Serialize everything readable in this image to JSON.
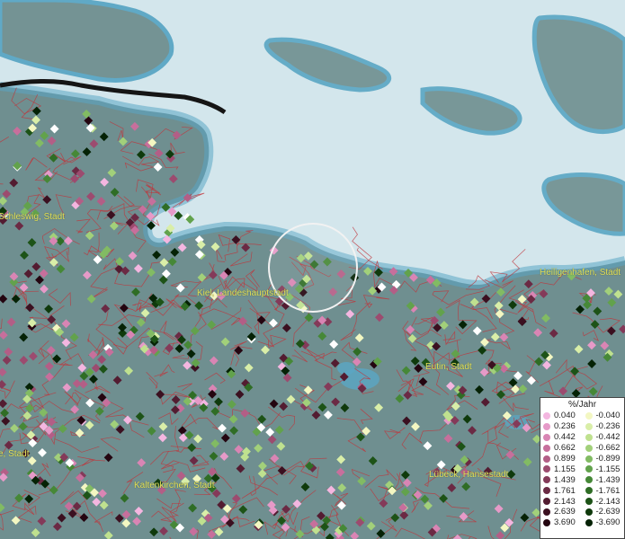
{
  "map": {
    "cities": [
      {
        "id": "schleswig",
        "label": "Schleswig, Stadt"
      },
      {
        "id": "kiel",
        "label": "Kiel, Landeshauptstadt"
      },
      {
        "id": "heiligenhafen",
        "label": "Heiligenhafen, Stadt"
      },
      {
        "id": "eutin",
        "label": "Eutin, Stadt"
      },
      {
        "id": "rendsburg",
        "label": "e, Stadt"
      },
      {
        "id": "kaltenkirchen",
        "label": "Kaltenkirchen, Stadt"
      },
      {
        "id": "luebeck",
        "label": "Lübeck, Hansestadt"
      }
    ],
    "colors": {
      "sea": "#cfe3ea",
      "land": "#6f8f90",
      "borders": "#c0333a",
      "city_label": "#e6e15a"
    }
  },
  "legend": {
    "title": "%/Jahr",
    "positive": [
      {
        "value": "0.040",
        "color": "#f4b6e0"
      },
      {
        "value": "0.236",
        "color": "#e69ac8"
      },
      {
        "value": "0.442",
        "color": "#d985b4"
      },
      {
        "value": "0.662",
        "color": "#c76f9c"
      },
      {
        "value": "0.899",
        "color": "#b35e86"
      },
      {
        "value": "1.155",
        "color": "#9c4b6f"
      },
      {
        "value": "1.439",
        "color": "#843a59"
      },
      {
        "value": "1.761",
        "color": "#6b2a44"
      },
      {
        "value": "2.143",
        "color": "#531c31"
      },
      {
        "value": "2.639",
        "color": "#3b1020"
      },
      {
        "value": "3.690",
        "color": "#240510"
      }
    ],
    "negative": [
      {
        "value": "-0.040",
        "color": "#f3f7c2"
      },
      {
        "value": "-0.236",
        "color": "#d9eea8"
      },
      {
        "value": "-0.442",
        "color": "#bfe18f"
      },
      {
        "value": "-0.662",
        "color": "#a2d07a"
      },
      {
        "value": "-0.899",
        "color": "#82bb63"
      },
      {
        "value": "-1.155",
        "color": "#62a24c"
      },
      {
        "value": "-1.439",
        "color": "#468837"
      },
      {
        "value": "-1.761",
        "color": "#2f6d25"
      },
      {
        "value": "-2.143",
        "color": "#1d5317"
      },
      {
        "value": "-2.639",
        "color": "#0f3a0c"
      },
      {
        "value": "-3.690",
        "color": "#052205"
      }
    ]
  }
}
